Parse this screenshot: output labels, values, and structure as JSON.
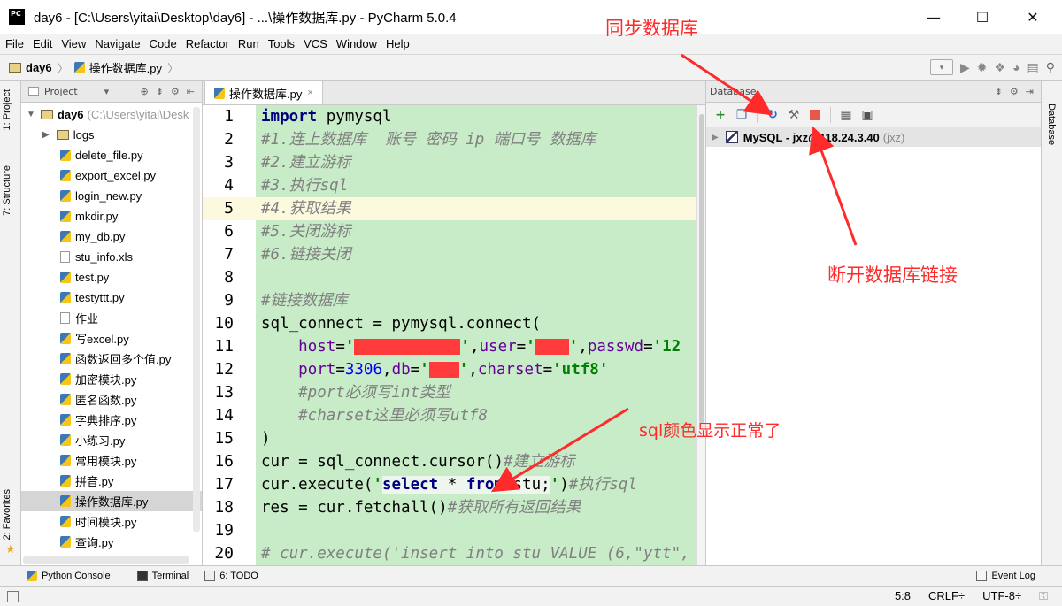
{
  "window": {
    "app_icon": "PC",
    "title": "day6 - [C:\\Users\\yitai\\Desktop\\day6] - ...\\操作数据库.py - PyCharm 5.0.4",
    "minimize": "—",
    "maximize": "☐",
    "close": "✕"
  },
  "menu": [
    "File",
    "Edit",
    "View",
    "Navigate",
    "Code",
    "Refactor",
    "Run",
    "Tools",
    "VCS",
    "Window",
    "Help"
  ],
  "breadcrumb": {
    "project": "day6",
    "file": "操作数据库.py"
  },
  "left_tool_tabs": {
    "project": "1: Project",
    "structure": "7: Structure",
    "favorites": "2: Favorites"
  },
  "right_tool_tabs": {
    "database": "Database"
  },
  "project_panel": {
    "header": "Project",
    "root_name": "day6",
    "root_path": "(C:\\Users\\yitai\\Desk",
    "items": [
      {
        "name": "logs",
        "type": "folder"
      },
      {
        "name": "delete_file.py",
        "type": "py"
      },
      {
        "name": "export_excel.py",
        "type": "py"
      },
      {
        "name": "login_new.py",
        "type": "py"
      },
      {
        "name": "mkdir.py",
        "type": "py"
      },
      {
        "name": "my_db.py",
        "type": "py"
      },
      {
        "name": "stu_info.xls",
        "type": "file"
      },
      {
        "name": "test.py",
        "type": "py"
      },
      {
        "name": "testyttt.py",
        "type": "py"
      },
      {
        "name": "作业",
        "type": "file"
      },
      {
        "name": "写excel.py",
        "type": "py"
      },
      {
        "name": "函数返回多个值.py",
        "type": "py"
      },
      {
        "name": "加密模块.py",
        "type": "py"
      },
      {
        "name": "匿名函数.py",
        "type": "py"
      },
      {
        "name": "字典排序.py",
        "type": "py"
      },
      {
        "name": "小练习.py",
        "type": "py"
      },
      {
        "name": "常用模块.py",
        "type": "py"
      },
      {
        "name": "拼音.py",
        "type": "py"
      },
      {
        "name": "操作数据库.py",
        "type": "py",
        "selected": true
      },
      {
        "name": "时间模块.py",
        "type": "py"
      },
      {
        "name": "查询.py",
        "type": "py"
      }
    ]
  },
  "editor": {
    "tab_label": "操作数据库.py",
    "tab_close": "×",
    "current_line": 5,
    "line_numbers": [
      "1",
      "2",
      "3",
      "4",
      "5",
      "6",
      "7",
      "8",
      "9",
      "10",
      "11",
      "12",
      "13",
      "14",
      "15",
      "16",
      "17",
      "18",
      "19",
      "20"
    ]
  },
  "database_panel": {
    "header": "Database",
    "connection_name": "MySQL - jxz@118.24.3.40",
    "connection_user": "(jxz)"
  },
  "bottom_tabs": {
    "python_console": "Python Console",
    "terminal": "Terminal",
    "todo": "6: TODO",
    "event_log": "Event Log"
  },
  "status": {
    "position": "5:8",
    "line_sep": "CRLF÷",
    "encoding": "UTF-8÷"
  },
  "annotations": {
    "sync_db": "同步数据库",
    "disconnect_db": "断开数据库链接",
    "sql_color": "sql颜色显示正常了"
  },
  "colors": {
    "annotation_red": "#ff2a2a",
    "editor_bg": "#c8ebc8",
    "current_line": "#fdf9df",
    "redaction": "#ff3b3b"
  }
}
